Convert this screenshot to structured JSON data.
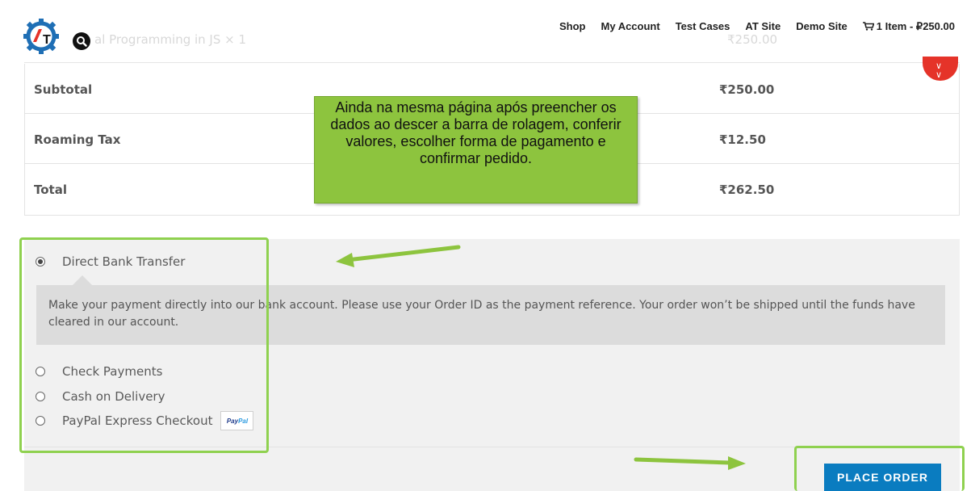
{
  "header": {
    "ghost_item_text": "al Programming in JS  × 1",
    "ghost_item_price": "₹250.00",
    "nav": [
      "Shop",
      "My Account",
      "Test Cases",
      "AT Site",
      "Demo Site"
    ],
    "cart_label": "1 Item - ₽250.00",
    "logo_letters": "AT"
  },
  "totals": {
    "rows": [
      {
        "label": "Subtotal",
        "value": "₹250.00"
      },
      {
        "label": "Roaming Tax",
        "value": "₹12.50"
      },
      {
        "label": "Total",
        "value": "₹262.50"
      }
    ]
  },
  "annotation": {
    "text": "Ainda na mesma página após preencher os dados ao descer a barra de rolagem, conferir valores, escolher forma de pagamento e confirmar pedido."
  },
  "payment": {
    "methods": [
      {
        "label": "Direct Bank Transfer",
        "checked": true
      },
      {
        "label": "Check Payments",
        "checked": false
      },
      {
        "label": "Cash on Delivery",
        "checked": false
      },
      {
        "label": "PayPal Express Checkout",
        "checked": false
      }
    ],
    "description": "Make your payment directly into our bank account. Please use your Order ID as the payment reference. Your order won’t be shipped until the funds have cleared in our account.",
    "paypal_logo": {
      "first": "Pay",
      "second": "Pal"
    },
    "place_order_label": "PLACE ORDER"
  },
  "colors": {
    "accent_blue": "#0a7cc0",
    "annotation_green": "#8dc43e",
    "highlight_green": "#8fd14f",
    "badge_red": "#e53329"
  }
}
